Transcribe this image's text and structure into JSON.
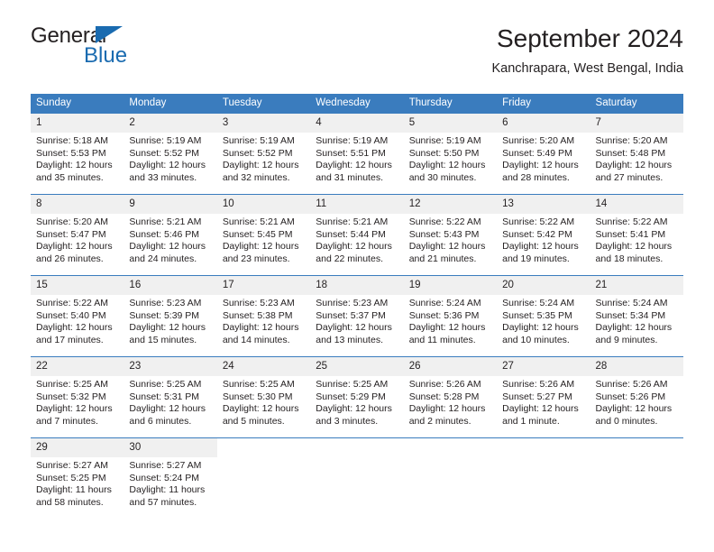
{
  "brand": {
    "name_part1": "General",
    "name_part2": "Blue",
    "triangle_color": "#1a6bb0"
  },
  "header": {
    "title": "September 2024",
    "subtitle": "Kanchrapara, West Bengal, India",
    "accent_color": "#3a7cbe",
    "daynum_band_color": "#f0f0f0"
  },
  "weekday_headers": [
    "Sunday",
    "Monday",
    "Tuesday",
    "Wednesday",
    "Thursday",
    "Friday",
    "Saturday"
  ],
  "weeks": [
    [
      {
        "day": "1",
        "sunrise": "Sunrise: 5:18 AM",
        "sunset": "Sunset: 5:53 PM",
        "daylight_line1": "Daylight: 12 hours",
        "daylight_line2": "and 35 minutes."
      },
      {
        "day": "2",
        "sunrise": "Sunrise: 5:19 AM",
        "sunset": "Sunset: 5:52 PM",
        "daylight_line1": "Daylight: 12 hours",
        "daylight_line2": "and 33 minutes."
      },
      {
        "day": "3",
        "sunrise": "Sunrise: 5:19 AM",
        "sunset": "Sunset: 5:52 PM",
        "daylight_line1": "Daylight: 12 hours",
        "daylight_line2": "and 32 minutes."
      },
      {
        "day": "4",
        "sunrise": "Sunrise: 5:19 AM",
        "sunset": "Sunset: 5:51 PM",
        "daylight_line1": "Daylight: 12 hours",
        "daylight_line2": "and 31 minutes."
      },
      {
        "day": "5",
        "sunrise": "Sunrise: 5:19 AM",
        "sunset": "Sunset: 5:50 PM",
        "daylight_line1": "Daylight: 12 hours",
        "daylight_line2": "and 30 minutes."
      },
      {
        "day": "6",
        "sunrise": "Sunrise: 5:20 AM",
        "sunset": "Sunset: 5:49 PM",
        "daylight_line1": "Daylight: 12 hours",
        "daylight_line2": "and 28 minutes."
      },
      {
        "day": "7",
        "sunrise": "Sunrise: 5:20 AM",
        "sunset": "Sunset: 5:48 PM",
        "daylight_line1": "Daylight: 12 hours",
        "daylight_line2": "and 27 minutes."
      }
    ],
    [
      {
        "day": "8",
        "sunrise": "Sunrise: 5:20 AM",
        "sunset": "Sunset: 5:47 PM",
        "daylight_line1": "Daylight: 12 hours",
        "daylight_line2": "and 26 minutes."
      },
      {
        "day": "9",
        "sunrise": "Sunrise: 5:21 AM",
        "sunset": "Sunset: 5:46 PM",
        "daylight_line1": "Daylight: 12 hours",
        "daylight_line2": "and 24 minutes."
      },
      {
        "day": "10",
        "sunrise": "Sunrise: 5:21 AM",
        "sunset": "Sunset: 5:45 PM",
        "daylight_line1": "Daylight: 12 hours",
        "daylight_line2": "and 23 minutes."
      },
      {
        "day": "11",
        "sunrise": "Sunrise: 5:21 AM",
        "sunset": "Sunset: 5:44 PM",
        "daylight_line1": "Daylight: 12 hours",
        "daylight_line2": "and 22 minutes."
      },
      {
        "day": "12",
        "sunrise": "Sunrise: 5:22 AM",
        "sunset": "Sunset: 5:43 PM",
        "daylight_line1": "Daylight: 12 hours",
        "daylight_line2": "and 21 minutes."
      },
      {
        "day": "13",
        "sunrise": "Sunrise: 5:22 AM",
        "sunset": "Sunset: 5:42 PM",
        "daylight_line1": "Daylight: 12 hours",
        "daylight_line2": "and 19 minutes."
      },
      {
        "day": "14",
        "sunrise": "Sunrise: 5:22 AM",
        "sunset": "Sunset: 5:41 PM",
        "daylight_line1": "Daylight: 12 hours",
        "daylight_line2": "and 18 minutes."
      }
    ],
    [
      {
        "day": "15",
        "sunrise": "Sunrise: 5:22 AM",
        "sunset": "Sunset: 5:40 PM",
        "daylight_line1": "Daylight: 12 hours",
        "daylight_line2": "and 17 minutes."
      },
      {
        "day": "16",
        "sunrise": "Sunrise: 5:23 AM",
        "sunset": "Sunset: 5:39 PM",
        "daylight_line1": "Daylight: 12 hours",
        "daylight_line2": "and 15 minutes."
      },
      {
        "day": "17",
        "sunrise": "Sunrise: 5:23 AM",
        "sunset": "Sunset: 5:38 PM",
        "daylight_line1": "Daylight: 12 hours",
        "daylight_line2": "and 14 minutes."
      },
      {
        "day": "18",
        "sunrise": "Sunrise: 5:23 AM",
        "sunset": "Sunset: 5:37 PM",
        "daylight_line1": "Daylight: 12 hours",
        "daylight_line2": "and 13 minutes."
      },
      {
        "day": "19",
        "sunrise": "Sunrise: 5:24 AM",
        "sunset": "Sunset: 5:36 PM",
        "daylight_line1": "Daylight: 12 hours",
        "daylight_line2": "and 11 minutes."
      },
      {
        "day": "20",
        "sunrise": "Sunrise: 5:24 AM",
        "sunset": "Sunset: 5:35 PM",
        "daylight_line1": "Daylight: 12 hours",
        "daylight_line2": "and 10 minutes."
      },
      {
        "day": "21",
        "sunrise": "Sunrise: 5:24 AM",
        "sunset": "Sunset: 5:34 PM",
        "daylight_line1": "Daylight: 12 hours",
        "daylight_line2": "and 9 minutes."
      }
    ],
    [
      {
        "day": "22",
        "sunrise": "Sunrise: 5:25 AM",
        "sunset": "Sunset: 5:32 PM",
        "daylight_line1": "Daylight: 12 hours",
        "daylight_line2": "and 7 minutes."
      },
      {
        "day": "23",
        "sunrise": "Sunrise: 5:25 AM",
        "sunset": "Sunset: 5:31 PM",
        "daylight_line1": "Daylight: 12 hours",
        "daylight_line2": "and 6 minutes."
      },
      {
        "day": "24",
        "sunrise": "Sunrise: 5:25 AM",
        "sunset": "Sunset: 5:30 PM",
        "daylight_line1": "Daylight: 12 hours",
        "daylight_line2": "and 5 minutes."
      },
      {
        "day": "25",
        "sunrise": "Sunrise: 5:25 AM",
        "sunset": "Sunset: 5:29 PM",
        "daylight_line1": "Daylight: 12 hours",
        "daylight_line2": "and 3 minutes."
      },
      {
        "day": "26",
        "sunrise": "Sunrise: 5:26 AM",
        "sunset": "Sunset: 5:28 PM",
        "daylight_line1": "Daylight: 12 hours",
        "daylight_line2": "and 2 minutes."
      },
      {
        "day": "27",
        "sunrise": "Sunrise: 5:26 AM",
        "sunset": "Sunset: 5:27 PM",
        "daylight_line1": "Daylight: 12 hours",
        "daylight_line2": "and 1 minute."
      },
      {
        "day": "28",
        "sunrise": "Sunrise: 5:26 AM",
        "sunset": "Sunset: 5:26 PM",
        "daylight_line1": "Daylight: 12 hours",
        "daylight_line2": "and 0 minutes."
      }
    ],
    [
      {
        "day": "29",
        "sunrise": "Sunrise: 5:27 AM",
        "sunset": "Sunset: 5:25 PM",
        "daylight_line1": "Daylight: 11 hours",
        "daylight_line2": "and 58 minutes."
      },
      {
        "day": "30",
        "sunrise": "Sunrise: 5:27 AM",
        "sunset": "Sunset: 5:24 PM",
        "daylight_line1": "Daylight: 11 hours",
        "daylight_line2": "and 57 minutes."
      },
      {
        "day": "",
        "sunrise": "",
        "sunset": "",
        "daylight_line1": "",
        "daylight_line2": ""
      },
      {
        "day": "",
        "sunrise": "",
        "sunset": "",
        "daylight_line1": "",
        "daylight_line2": ""
      },
      {
        "day": "",
        "sunrise": "",
        "sunset": "",
        "daylight_line1": "",
        "daylight_line2": ""
      },
      {
        "day": "",
        "sunrise": "",
        "sunset": "",
        "daylight_line1": "",
        "daylight_line2": ""
      },
      {
        "day": "",
        "sunrise": "",
        "sunset": "",
        "daylight_line1": "",
        "daylight_line2": ""
      }
    ]
  ]
}
